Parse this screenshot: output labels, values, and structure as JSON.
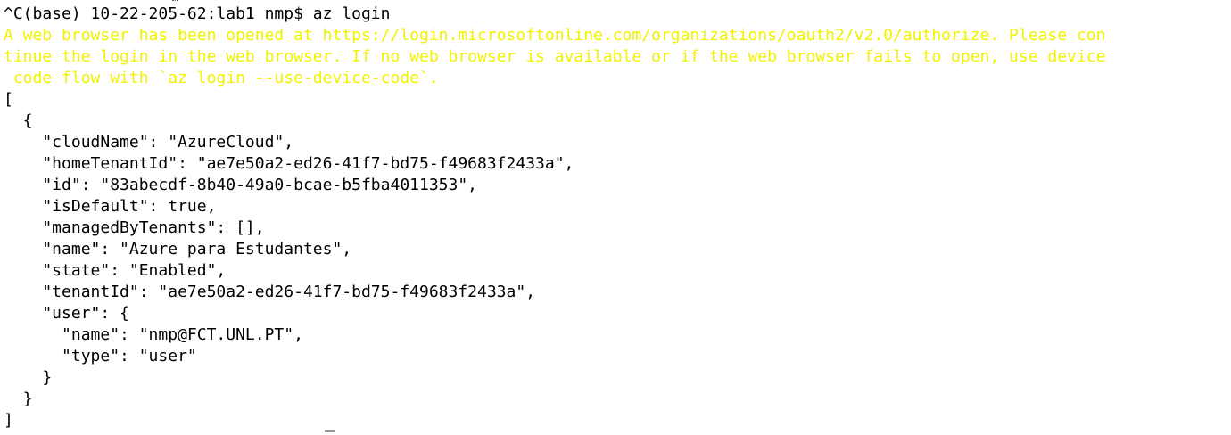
{
  "terminal": {
    "prompt": "^C(base) 10-22-205-62:lab1 nmp$ az login",
    "warning": [
      "A web browser has been opened at https://login.microsoftonline.com/organizations/oauth2/v2.0/authorize. Please con",
      "tinue the login in the web browser. If no web browser is available or if the web browser fails to open, use device",
      " code flow with `az login --use-device-code`."
    ],
    "output": [
      "[",
      "  {",
      "    \"cloudName\": \"AzureCloud\",",
      "    \"homeTenantId\": \"ae7e50a2-ed26-41f7-bd75-f49683f2433a\",",
      "    \"id\": \"83abecdf-8b40-49a0-bcae-b5fba4011353\",",
      "    \"isDefault\": true,",
      "    \"managedByTenants\": [],",
      "    \"name\": \"Azure para Estudantes\",",
      "    \"state\": \"Enabled\",",
      "    \"tenantId\": \"ae7e50a2-ed26-41f7-bd75-f49683f2433a\",",
      "    \"user\": {",
      "      \"name\": \"nmp@FCT.UNL.PT\",",
      "      \"type\": \"user\"",
      "    }",
      "  }",
      "]"
    ],
    "colors": {
      "background": "#ffffff",
      "text": "#000000",
      "warning": "#f2f200"
    }
  }
}
